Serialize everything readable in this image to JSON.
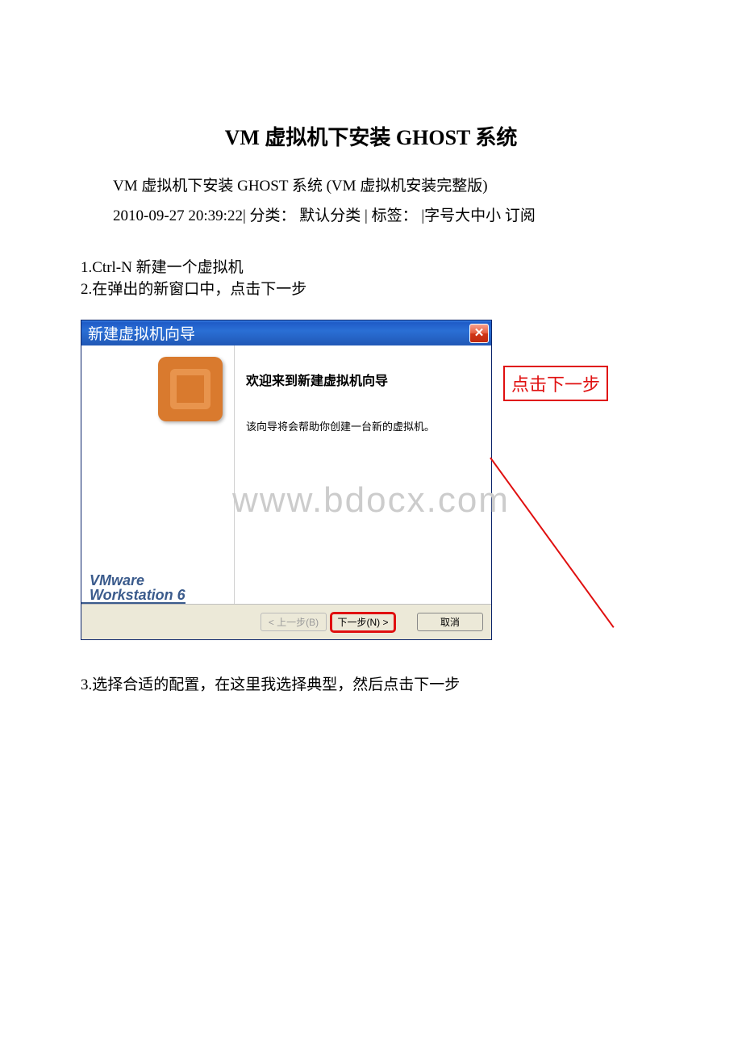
{
  "document": {
    "title": "VM 虚拟机下安装 GHOST 系统",
    "subtitle": "VM 虚拟机下安装 GHOST 系统 (VM 虚拟机安装完整版)",
    "meta": "2010-09-27 20:39:22| 分类：  默认分类 | 标签： |字号大中小 订阅",
    "step1": "1.Ctrl-N 新建一个虚拟机",
    "step2": "2.在弹出的新窗口中，点击下一步",
    "step3": "3.选择合适的配置，在这里我选择典型，然后点击下一步"
  },
  "dialog": {
    "titlebar": "新建虚拟机向导",
    "heading": "欢迎来到新建虚拟机向导",
    "description": "该向导将会帮助你创建一台新的虚拟机。",
    "brand_line1": "VMware",
    "brand_line2": "Workstation 6",
    "buttons": {
      "back": "< 上一步(B)",
      "next": "下一步(N) >",
      "cancel": "取消"
    }
  },
  "callout": {
    "text": "点击下一步"
  },
  "watermark": "www.bdocx.com"
}
